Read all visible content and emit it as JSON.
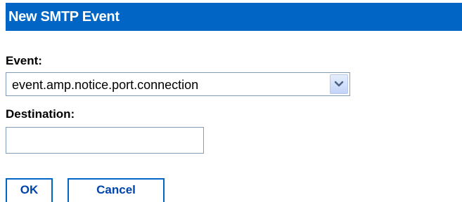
{
  "dialog": {
    "title": "New SMTP Event"
  },
  "form": {
    "event": {
      "label": "Event:",
      "selected_value": "event.amp.notice.port.connection"
    },
    "destination": {
      "label": "Destination:",
      "value": "",
      "placeholder": ""
    }
  },
  "buttons": {
    "ok_label": "OK",
    "cancel_label": "Cancel"
  },
  "icons": {
    "dropdown": "chevron-down-icon"
  },
  "colors": {
    "title_bar": "#0065c4",
    "title_text": "#ffffff",
    "button_border": "#0065c4",
    "button_text": "#0044aa"
  }
}
